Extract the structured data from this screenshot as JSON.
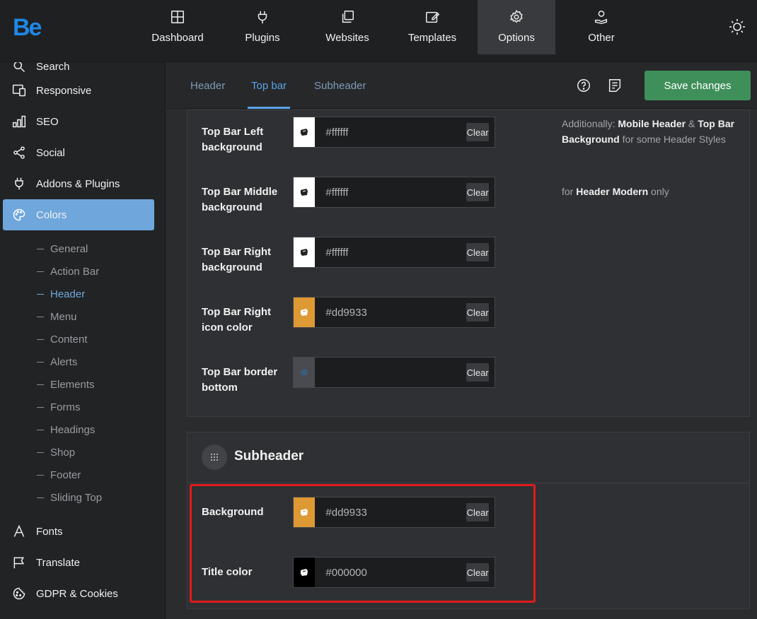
{
  "brand": {
    "logo": "Be",
    "accent": "#1e88e5"
  },
  "topnav": {
    "items": [
      {
        "label": "Dashboard",
        "icon": "dashboard-icon"
      },
      {
        "label": "Plugins",
        "icon": "plug-icon"
      },
      {
        "label": "Websites",
        "icon": "websites-icon"
      },
      {
        "label": "Templates",
        "icon": "templates-icon"
      },
      {
        "label": "Options",
        "icon": "gear-icon",
        "active": true
      },
      {
        "label": "Other",
        "icon": "hand-icon"
      }
    ],
    "theme_toggle": "sun-icon"
  },
  "sidebar": {
    "items": [
      {
        "label": "Search",
        "icon": "search-icon"
      },
      {
        "label": "Responsive",
        "icon": "responsive-icon"
      },
      {
        "label": "SEO",
        "icon": "seo-icon"
      },
      {
        "label": "Social",
        "icon": "share-icon"
      },
      {
        "label": "Addons & Plugins",
        "icon": "plug-icon"
      },
      {
        "label": "Colors",
        "icon": "palette-icon",
        "active": true
      },
      {
        "label": "Fonts",
        "icon": "font-icon"
      },
      {
        "label": "Translate",
        "icon": "flag-icon"
      },
      {
        "label": "GDPR & Cookies",
        "icon": "cookie-icon"
      }
    ],
    "subitems": [
      {
        "label": "General"
      },
      {
        "label": "Action Bar"
      },
      {
        "label": "Header",
        "active": true
      },
      {
        "label": "Menu"
      },
      {
        "label": "Content"
      },
      {
        "label": "Alerts"
      },
      {
        "label": "Elements"
      },
      {
        "label": "Forms"
      },
      {
        "label": "Headings"
      },
      {
        "label": "Shop"
      },
      {
        "label": "Footer"
      },
      {
        "label": "Sliding Top"
      }
    ],
    "active_color": "#6fa7dc"
  },
  "tabs": [
    {
      "label": "Header"
    },
    {
      "label": "Top bar",
      "active": true
    },
    {
      "label": "Subheader"
    }
  ],
  "toolbar": {
    "help_icon": "help-icon",
    "notes_icon": "notes-icon",
    "save_label": "Save changes",
    "save_color": "#3f8f5a"
  },
  "topbar_rows": [
    {
      "label": "Top Bar Left background",
      "swatch": "#ffffff",
      "value": "#ffffff",
      "clear": "Clear"
    },
    {
      "label": "Top Bar Middle background",
      "swatch": "#ffffff",
      "value": "#ffffff",
      "clear": "Clear"
    },
    {
      "label": "Top Bar Right background",
      "swatch": "#ffffff",
      "value": "#ffffff",
      "clear": "Clear"
    },
    {
      "label": "Top Bar Right icon color",
      "swatch": "#dd9933",
      "value": "#dd9933",
      "clear": "Clear"
    },
    {
      "label": "Top Bar border bottom",
      "swatch": "#4a4b50",
      "value": "",
      "clear": "Clear"
    }
  ],
  "notes": {
    "n1_pre": "Additionally: ",
    "n1_b1": "Mobile Header",
    "n1_mid": " & ",
    "n1_b2": "Top Bar Background",
    "n1_post": " for some Header Styles",
    "n2_pre": "for ",
    "n2_b": "Header Modern",
    "n2_post": " only"
  },
  "subheader": {
    "title": "Subheader",
    "drag_icon": "drag-handle-icon",
    "rows": [
      {
        "label": "Background",
        "swatch": "#dd9933",
        "value": "#dd9933",
        "clear": "Clear"
      },
      {
        "label": "Title color",
        "swatch": "#000000",
        "value": "#000000",
        "clear": "Clear"
      }
    ]
  }
}
